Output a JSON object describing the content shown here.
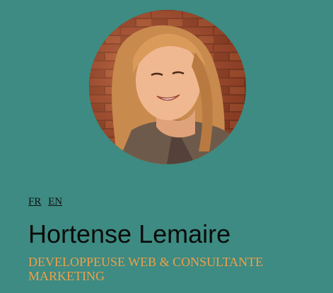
{
  "profile": {
    "photo": "portrait of smiling woman in front of brick wall",
    "languages": [
      {
        "code": "FR"
      },
      {
        "code": "EN"
      }
    ],
    "name": "Hortense Lemaire",
    "title": "DEVELOPPEUSE WEB & CONSULTANTE MARKETING"
  },
  "colors": {
    "background": "#3d8b82",
    "name_text": "#0b0b0b",
    "title_text": "#f0a04a"
  }
}
